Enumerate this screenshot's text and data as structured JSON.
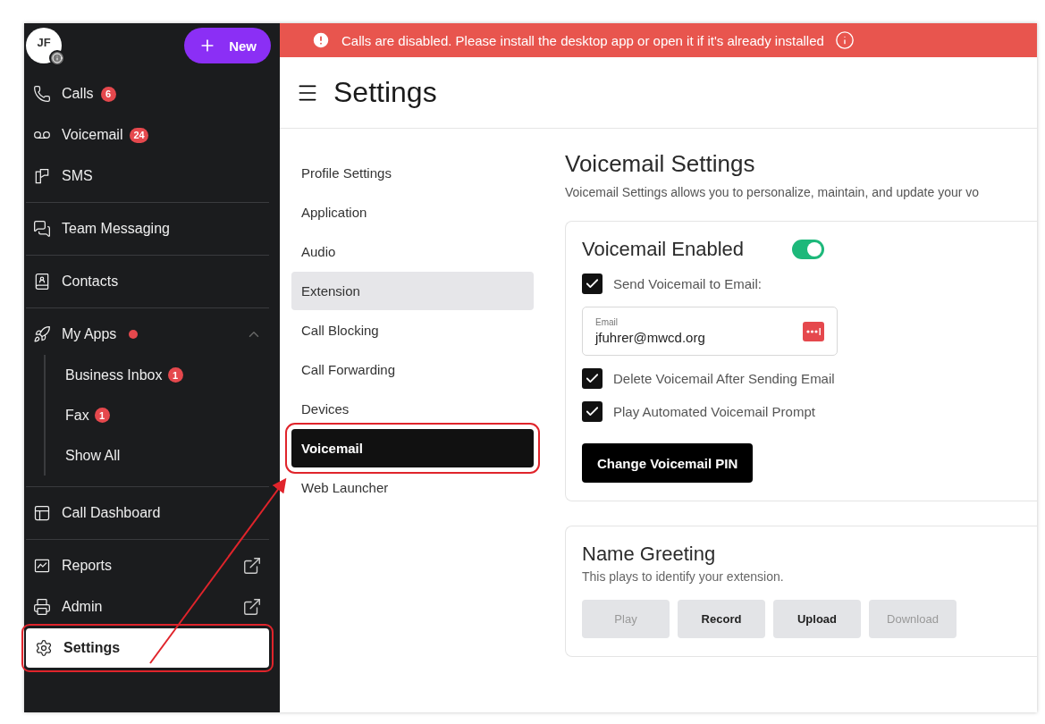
{
  "user": {
    "initials": "JF"
  },
  "new_button": {
    "label": "New"
  },
  "sidebar": {
    "sections": [
      [
        {
          "label": "Calls",
          "badge": "6",
          "selected": false,
          "highlighted": false
        },
        {
          "label": "Voicemail",
          "badge": "24",
          "selected": false,
          "highlighted": false
        },
        {
          "label": "SMS",
          "selected": false,
          "highlighted": false
        }
      ],
      [
        {
          "label": "Team Messaging",
          "selected": false
        }
      ],
      [
        {
          "label": "Contacts",
          "selected": false
        }
      ],
      [
        {
          "label": "My Apps",
          "dot": true,
          "expanded": true,
          "selected": false,
          "children": [
            {
              "label": "Business Inbox",
              "badge": "1"
            },
            {
              "label": "Fax",
              "badge": "1"
            },
            {
              "label": "Show All"
            }
          ]
        }
      ],
      [
        {
          "label": "Call Dashboard",
          "selected": false
        }
      ],
      [
        {
          "label": "Reports",
          "external": true,
          "selected": false,
          "highlighted": false
        },
        {
          "label": "Admin",
          "external": true,
          "selected": false,
          "highlighted": false
        },
        {
          "label": "Settings",
          "selected": true,
          "highlighted": true
        }
      ]
    ]
  },
  "banner": {
    "text": "Calls are disabled. Please install the desktop app or open it if it's already installed"
  },
  "page_title": "Settings",
  "settings_menu": [
    {
      "label": "Profile Settings",
      "selected": false,
      "hovered": false,
      "highlighted": false
    },
    {
      "label": "Application",
      "selected": false,
      "hovered": false,
      "highlighted": false
    },
    {
      "label": "Audio",
      "selected": false,
      "hovered": false,
      "highlighted": false
    },
    {
      "label": "Extension",
      "selected": false,
      "hovered": true,
      "highlighted": false
    },
    {
      "label": "Call Blocking",
      "selected": false,
      "hovered": false,
      "highlighted": false
    },
    {
      "label": "Call Forwarding",
      "selected": false,
      "hovered": false,
      "highlighted": false
    },
    {
      "label": "Devices",
      "selected": false,
      "hovered": false,
      "highlighted": false
    },
    {
      "label": "Voicemail",
      "selected": true,
      "hovered": false,
      "highlighted": true
    },
    {
      "label": "Web Launcher",
      "selected": false,
      "hovered": false,
      "highlighted": false
    }
  ],
  "content": {
    "title": "Voicemail Settings",
    "description": "Voicemail Settings allows you to personalize, maintain, and update your vo",
    "voicemail_card": {
      "title": "Voicemail Enabled",
      "on": true,
      "options": [
        {
          "kind": "checkbox",
          "label": "Send Voicemail to Email:",
          "checked": true
        },
        {
          "kind": "field",
          "label": "Email",
          "value": "jfuhrer@mwcd.org"
        },
        {
          "kind": "checkbox",
          "label": "Delete Voicemail After Sending Email",
          "checked": true
        },
        {
          "kind": "checkbox",
          "label": "Play Automated Voicemail Prompt",
          "checked": true
        }
      ],
      "button": "Change Voicemail PIN"
    },
    "greeting_card": {
      "title": "Name Greeting",
      "description": "This plays to identify your extension.",
      "buttons": [
        {
          "label": "Play",
          "disabled": true
        },
        {
          "label": "Record",
          "disabled": false
        },
        {
          "label": "Upload",
          "disabled": false
        },
        {
          "label": "Download",
          "disabled": true
        }
      ]
    }
  }
}
